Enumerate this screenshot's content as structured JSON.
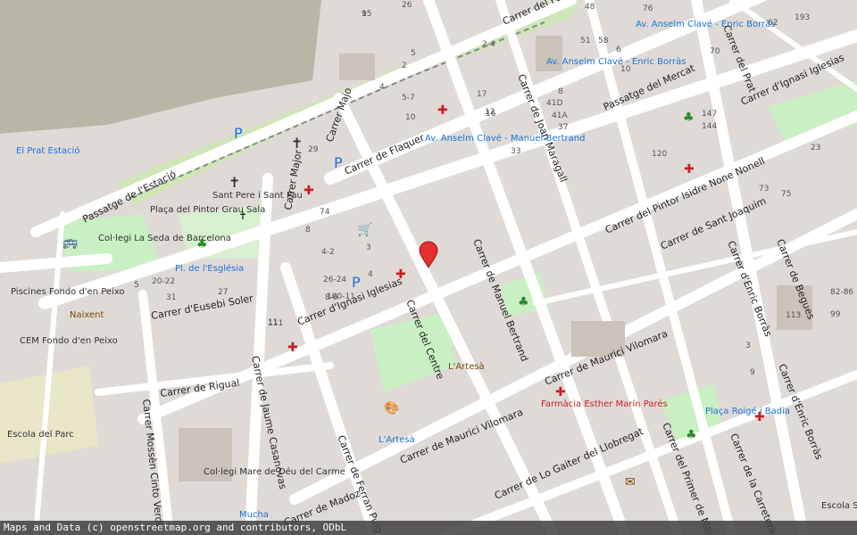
{
  "attribution": "Maps and Data (c) openstreetmap.org and contributors, ODbL",
  "streets": {
    "estacio": "de l'Estació",
    "flaquer": "Carrer de Flaquer",
    "joan_maragall": "Carrer de Joan Maragall",
    "ferrocarril": "Carrer del Ferro",
    "mercat": "Passatge del Mercat",
    "prat": "Carrer del Prat",
    "ignasi_top": "Carrer d'Ignasi Iglesias",
    "pintor_nonell": "Carrer del Pintor Isidre None Nonell",
    "sant_joaquim": "Carrer de Sant Joaquim",
    "begues": "Carrer de Begues",
    "enric_borras_1": "Carrer d'Enric Borràs",
    "enric_borras_2": "Carrer d'Enric Borràs",
    "ignasi_main": "Carrer d'Ignasi Iglesias",
    "eusebi_soler": "Carrer d'Eusebi Soler",
    "centre": "Carrer del Centre",
    "manuel_bertrand": "Carrer de Manuel Bertrand",
    "maurici_1": "Carrer de Maurici Vilomara",
    "maurici_2": "Carrer de Maurici Vilomara",
    "rigual": "Carrer de Rigual",
    "mossen": "Carrer Mossèn Cinto Verda",
    "jaume": "Carrer de Jaume Casanovas",
    "ferran_puig": "Carrer de Ferran Puig",
    "madoz": "Carrer de Madoz",
    "gaiter": "Carrer de Lo Gaiter del Llobregat",
    "primer_maig": "Carrer del Primer de Maig",
    "carretera": "Carrer de la Carretera de",
    "major": "Carrer Major",
    "major2": "Carrer Majo",
    "passatge_estacio": "Passatge de l'Estació"
  },
  "pois": {
    "prat_estacio": "El Prat Estació",
    "el_prat_estacio2": "El Prat Estació",
    "sant_pere": "Sant Pere i Sant Pau",
    "placa_pintor": "Plaça del Pintor Grau Sala",
    "collegi_seda": "Col·legi La Seda de Barcelona",
    "pl_esglesia": "Pl. de l'Església",
    "piscines": "Piscines Fondo d'en Peixo",
    "naixent": "Naixent",
    "cem_fondo": "CEM Fondo d'en Peixo",
    "escola_parc": "Escola del Parc",
    "av_anselm_1": "Av. Anselm Clavé - Manuel Bertrand",
    "av_anselm_2": "Av. Anselm Clavé - Enric Borràs",
    "av_anselm_3": "Av. Anselm Clavé - Enric Borràs",
    "lartesa": "L'Artesà",
    "lartesa_bike": "L'Artesà",
    "farmacia": "Farmàcia Esther Marín Parés",
    "placa_roige": "Plaça Roigé i Badia",
    "collegi_mare": "Col·legi Mare de Déu del Carme",
    "mucha": "Mucha",
    "escola_sant": "Escola Sant Joan"
  },
  "numbers": [
    "15",
    "26",
    "48",
    "76",
    "193",
    "62",
    "51",
    "58",
    "10",
    "70",
    "2-4",
    "5",
    "8",
    "2",
    "41D",
    "41A",
    "37",
    "6",
    "147",
    "144",
    "17",
    "12",
    "16",
    "5-7",
    "4",
    "10",
    "33",
    "120",
    "23",
    "29",
    "73",
    "75",
    "74",
    "8",
    "4-2",
    "3",
    "4",
    "5",
    "20-22",
    "31",
    "27",
    "26-24",
    "8-6",
    "11",
    "9",
    "3",
    "82-86",
    "99",
    "113",
    "100-11",
    "111",
    "9"
  ],
  "colors": {
    "land": "#e0dad6",
    "block": "#d9d0c9",
    "road": "#ffffff",
    "park": "#c8f0c2",
    "rail_area": "#b9b7aa",
    "marker": "#e62f2f",
    "poi_blue": "#1a73d9",
    "poi_red": "#c81e24",
    "poi_brown": "#734a08"
  },
  "marker": {
    "label": "location-pin"
  }
}
